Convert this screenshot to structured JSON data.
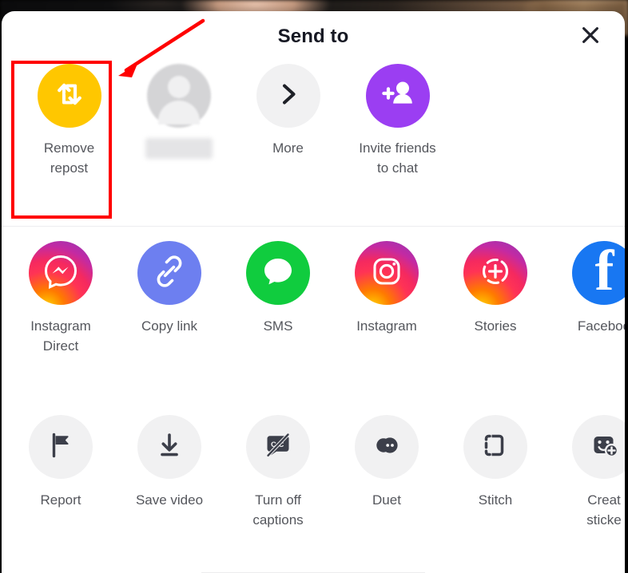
{
  "sheet": {
    "title": "Send to",
    "close_icon": "close-icon",
    "accent_colors": {
      "repost_yellow": "#ffc700",
      "invite_purple": "#9b3ef2",
      "copy_link_blue": "#6d7ff0",
      "sms_green": "#10cc3e",
      "facebook_blue": "#1877f2",
      "grey_bubble": "#f1f1f2",
      "label_text": "#54565c",
      "title_text": "#161823",
      "annotation_red": "#ff0000"
    }
  },
  "rows": {
    "primary": [
      {
        "label": "Remove\nrepost",
        "icon": "repost-icon",
        "highlighted": true
      },
      {
        "label": "",
        "icon": "user-avatar-icon",
        "redacted": true
      },
      {
        "label": "More",
        "icon": "chevron-right-icon"
      },
      {
        "label": "Invite friends\nto chat",
        "icon": "add-person-icon"
      }
    ],
    "share": [
      {
        "label": "Instagram\nDirect",
        "icon": "instagram-direct-icon"
      },
      {
        "label": "Copy link",
        "icon": "link-icon"
      },
      {
        "label": "SMS",
        "icon": "message-bubble-icon"
      },
      {
        "label": "Instagram",
        "icon": "instagram-icon"
      },
      {
        "label": "Stories",
        "icon": "instagram-stories-icon"
      },
      {
        "label": "Faceboo",
        "icon": "facebook-icon",
        "truncated": true
      }
    ],
    "actions": [
      {
        "label": "Report",
        "icon": "flag-icon"
      },
      {
        "label": "Save video",
        "icon": "download-icon"
      },
      {
        "label": "Turn off\ncaptions",
        "icon": "captions-off-icon"
      },
      {
        "label": "Duet",
        "icon": "duet-icon"
      },
      {
        "label": "Stitch",
        "icon": "stitch-icon"
      },
      {
        "label": "Creat\nsticke",
        "icon": "create-sticker-icon",
        "truncated": true
      }
    ]
  }
}
